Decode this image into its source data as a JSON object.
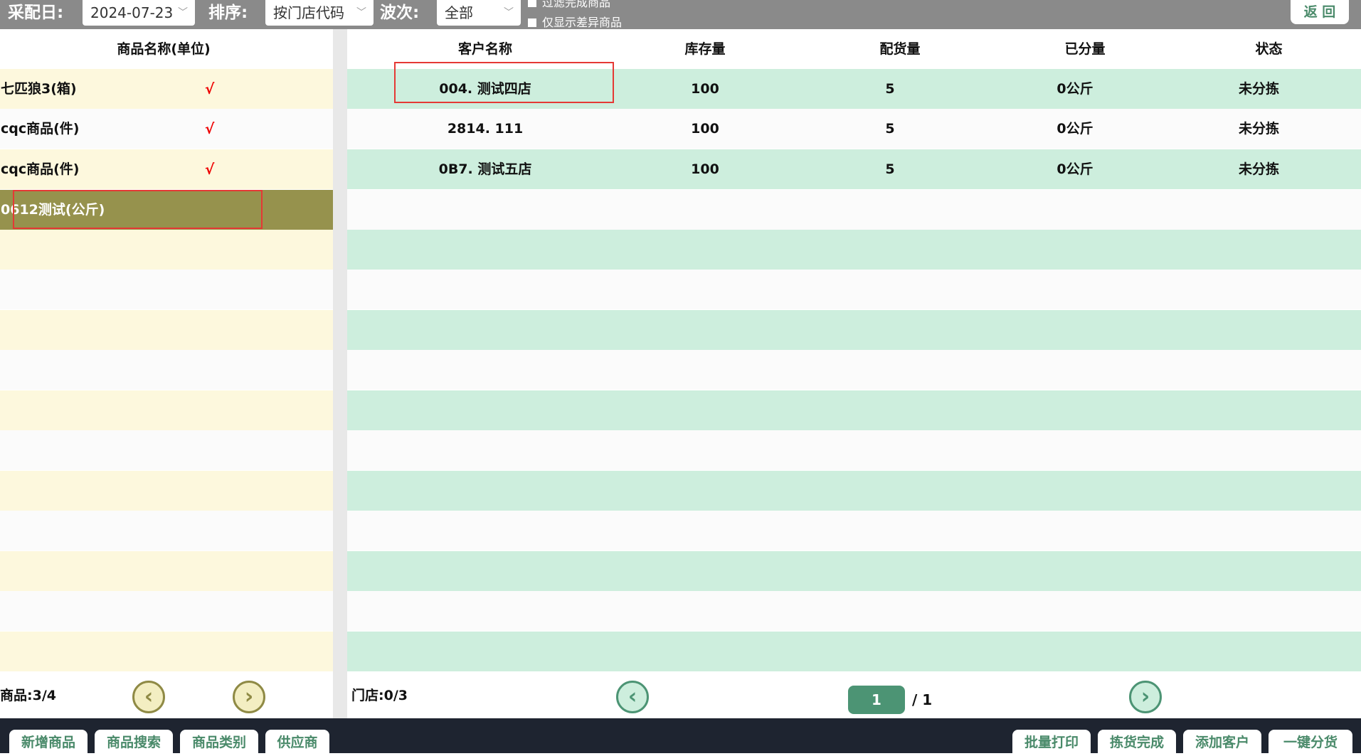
{
  "toolbar": {
    "date_label": "采配日:",
    "date_value": "2024-07-23",
    "sort_label": "排序:",
    "sort_value": "按门店代码",
    "wave_label": "波次:",
    "wave_value": "全部",
    "filter_done_label": "过滤完成商品",
    "only_diff_label": "仅显示差异商品",
    "back_label": "返 回"
  },
  "left": {
    "header": "商品名称(单位)",
    "items": [
      {
        "name": "七匹狼3(箱)",
        "mark": "√"
      },
      {
        "name": "cqc商品(件)",
        "mark": "√"
      },
      {
        "name": "cqc商品(件)",
        "mark": "√"
      },
      {
        "name": "0612测试(公斤)",
        "mark": ""
      }
    ],
    "count_text": "商品:3/4"
  },
  "right": {
    "headers": [
      "客户名称",
      "库存量",
      "配货量",
      "已分量",
      "状态"
    ],
    "rows": [
      {
        "customer": "004. 测试四店",
        "stock": "100",
        "alloc": "5",
        "done": "0公斤",
        "status": "未分拣"
      },
      {
        "customer": "2814. 111",
        "stock": "100",
        "alloc": "5",
        "done": "0公斤",
        "status": "未分拣"
      },
      {
        "customer": "0B7. 测试五店",
        "stock": "100",
        "alloc": "5",
        "done": "0公斤",
        "status": "未分拣"
      }
    ],
    "count_text": "门店:0/3",
    "page_current": "1",
    "page_total": "/ 1"
  },
  "icons": {
    "prev": "chevron-left-icon",
    "next": "chevron-right-icon",
    "chevron_down": "chevron-down-icon"
  },
  "bottom": {
    "left_buttons": [
      "新增商品",
      "商品搜索",
      "商品类别",
      "供应商"
    ],
    "right_buttons": [
      "批量打印",
      "拣货完成",
      "添加客户",
      "一键分货"
    ]
  },
  "colors": {
    "toolbar_bg": "#8a8a8a",
    "left_row_alt": "#fdf8dd",
    "left_row_selected": "#96924d",
    "right_row_alt": "#cdeedd",
    "accent_green": "#4c9474",
    "bottom_bar": "#1e2430",
    "highlight": "#e53935"
  }
}
